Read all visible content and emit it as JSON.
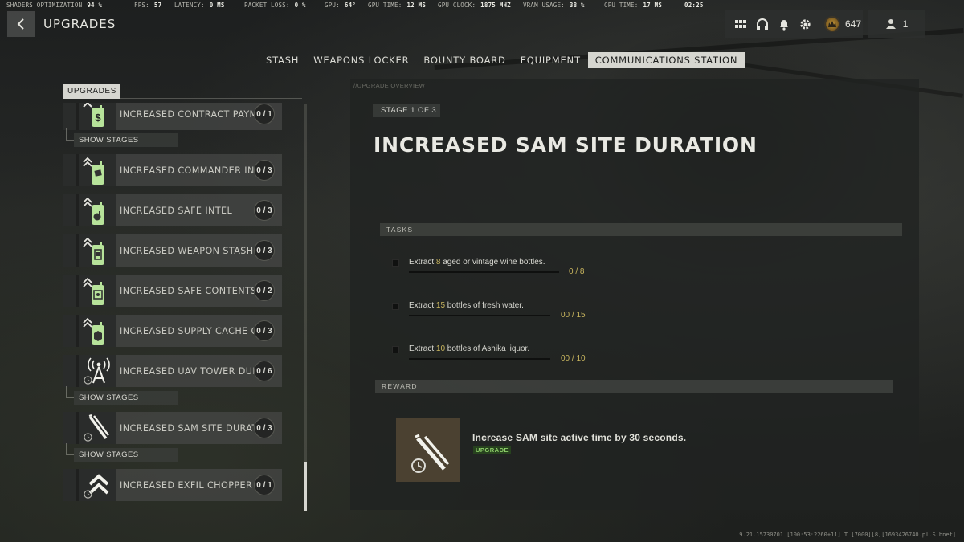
{
  "perf": [
    {
      "key": "SHADERS OPTIMIZATION",
      "value": "94 %"
    },
    {
      "key": "FPS:",
      "value": "57"
    },
    {
      "key": "LATENCY:",
      "value": "0 MS"
    },
    {
      "key": "PACKET LOSS:",
      "value": "0 %"
    },
    {
      "key": "GPU:",
      "value": "64°"
    },
    {
      "key": "GPU TIME:",
      "value": "12 MS"
    },
    {
      "key": "GPU CLOCK:",
      "value": "1875 MHZ"
    },
    {
      "key": "VRAM USAGE:",
      "value": "38 %"
    },
    {
      "key": "CPU TIME:",
      "value": "17 MS"
    },
    {
      "key": "",
      "value": "02:25"
    }
  ],
  "header": {
    "title": "UPGRADES",
    "currency": "647",
    "party_count": "1",
    "icons": [
      "grid-icon",
      "headset-icon",
      "bell-icon",
      "gear-icon"
    ]
  },
  "tabs": [
    {
      "label": "STASH",
      "active": false
    },
    {
      "label": "WEAPONS LOCKER",
      "active": false
    },
    {
      "label": "BOUNTY BOARD",
      "active": false
    },
    {
      "label": "EQUIPMENT",
      "active": false
    },
    {
      "label": "COMMUNICATIONS STATION",
      "active": true
    }
  ],
  "list": {
    "header": "UPGRADES",
    "show_stages_label": "SHOW STAGES",
    "items": [
      {
        "label": "INCREASED CONTRACT PAYMENT",
        "progress": "0 / 1",
        "icon": "money-radio-icon"
      },
      {
        "label": "INCREASED COMMANDER INTEL",
        "progress": "0 / 3",
        "icon": "radio-intel-icon"
      },
      {
        "label": "INCREASED SAFE INTEL",
        "progress": "0 / 3",
        "icon": "radio-bomb-icon"
      },
      {
        "label": "INCREASED WEAPON STASH INTEL",
        "progress": "0 / 3",
        "icon": "radio-weapon-icon"
      },
      {
        "label": "INCREASED SAFE CONTENTS",
        "progress": "0 / 2",
        "icon": "radio-safe-icon"
      },
      {
        "label": "INCREASED SUPPLY CACHE CONTENTS",
        "progress": "0 / 3",
        "icon": "radio-cache-icon"
      },
      {
        "label": "INCREASED UAV TOWER DURATION",
        "progress": "0 / 6",
        "icon": "uav-tower-icon"
      },
      {
        "label": "INCREASED SAM SITE DURATION",
        "progress": "0 / 3",
        "icon": "sam-missile-icon"
      },
      {
        "label": "INCREASED EXFIL CHOPPER SPEED",
        "progress": "0 / 1",
        "icon": "chevron-up-icon"
      }
    ]
  },
  "detail": {
    "crumb": "//UPGRADE OVERVIEW",
    "stage": "STAGE 1 OF 3",
    "title": "INCREASED SAM SITE DURATION",
    "tasks_label": "TASKS",
    "tasks": [
      {
        "pre": "Extract ",
        "num": "8",
        "post": " aged or vintage wine bottles.",
        "count": "0 / 8",
        "fraction": 0
      },
      {
        "pre": "Extract ",
        "num": "15",
        "post": " bottles of fresh water.",
        "count": "00 / 15",
        "fraction": 0
      },
      {
        "pre": "Extract ",
        "num": "10",
        "post": " bottles of Ashika liquor.",
        "count": "00 / 10",
        "fraction": 0
      }
    ],
    "reward_label": "REWARD",
    "reward_text": "Increase SAM site active time by 30 seconds.",
    "reward_badge": "UPGRADE"
  },
  "footer": "9.21.15730701 [100:53:2260+11] T [7000][8][1693426740.pl.S.bnet]",
  "colors": {
    "accent_yellow": "#c8b55e",
    "tab_active": "#d6d6d0",
    "icon_green": "#b7e39a",
    "upgrade_green": "#8ed06a"
  }
}
